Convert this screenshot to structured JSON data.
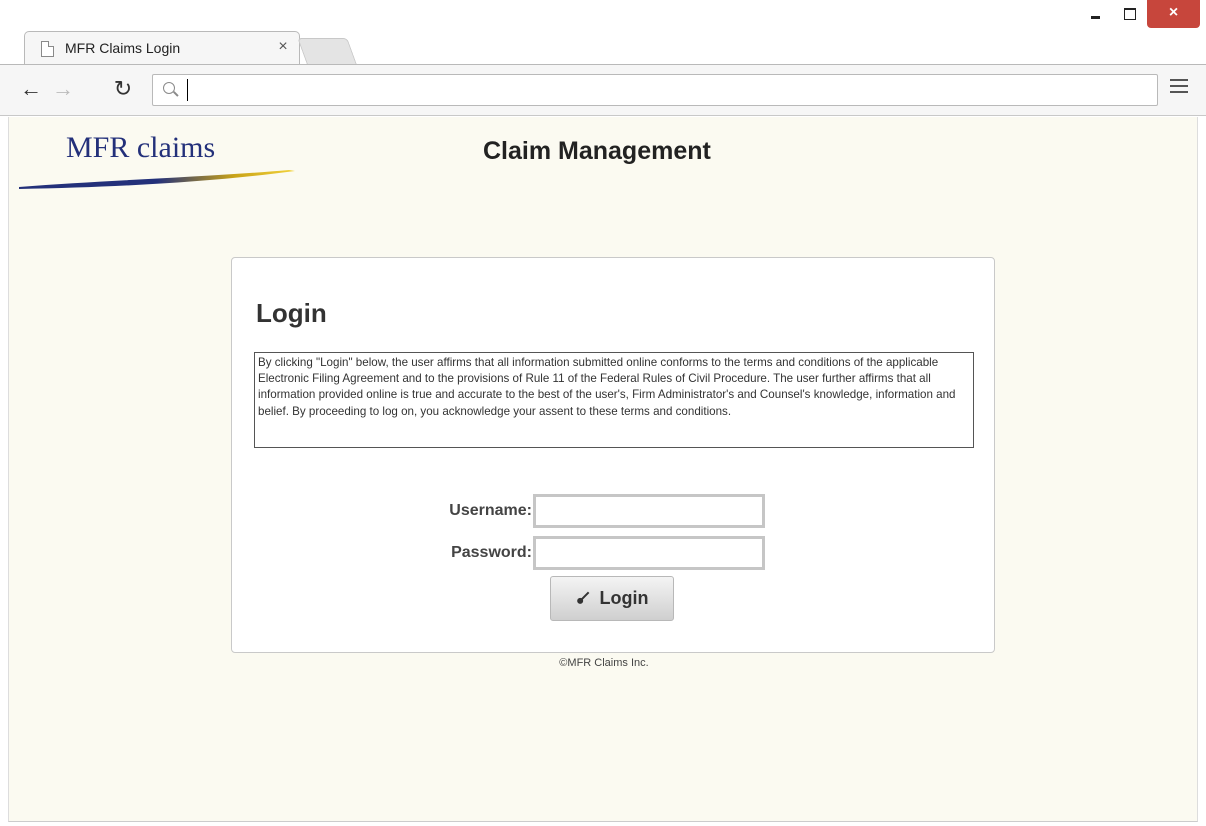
{
  "browser": {
    "tab_title": "MFR Claims Login",
    "tab_close_label": "×",
    "window_close_label": "×",
    "address_value": ""
  },
  "header": {
    "logo_text": "MFR claims",
    "app_title": "Claim Management",
    "logo_colors": {
      "text": "#23307a",
      "swoosh_blue": "#23307a",
      "swoosh_gold": "#e8c21c"
    }
  },
  "login": {
    "title": "Login",
    "disclaimer": "By clicking \"Login\" below, the user affirms that all information submitted online conforms to the terms and conditions of the applicable Electronic Filing Agreement and to the provisions of Rule 11 of the Federal Rules of Civil Procedure. The user further affirms that all information provided online is true and accurate to the best of the user's, Firm Administrator's and Counsel's knowledge, information and belief. By proceeding to log on, you acknowledge your assent to these terms and conditions.",
    "username_label": "Username:",
    "username_value": "",
    "password_label": "Password:",
    "password_value": "",
    "submit_label": "Login",
    "submit_icon": "key-icon"
  },
  "footer": {
    "copyright": "©MFR Claims Inc."
  },
  "colors": {
    "page_background": "#fbfaf1",
    "window_close": "#c7463c"
  }
}
